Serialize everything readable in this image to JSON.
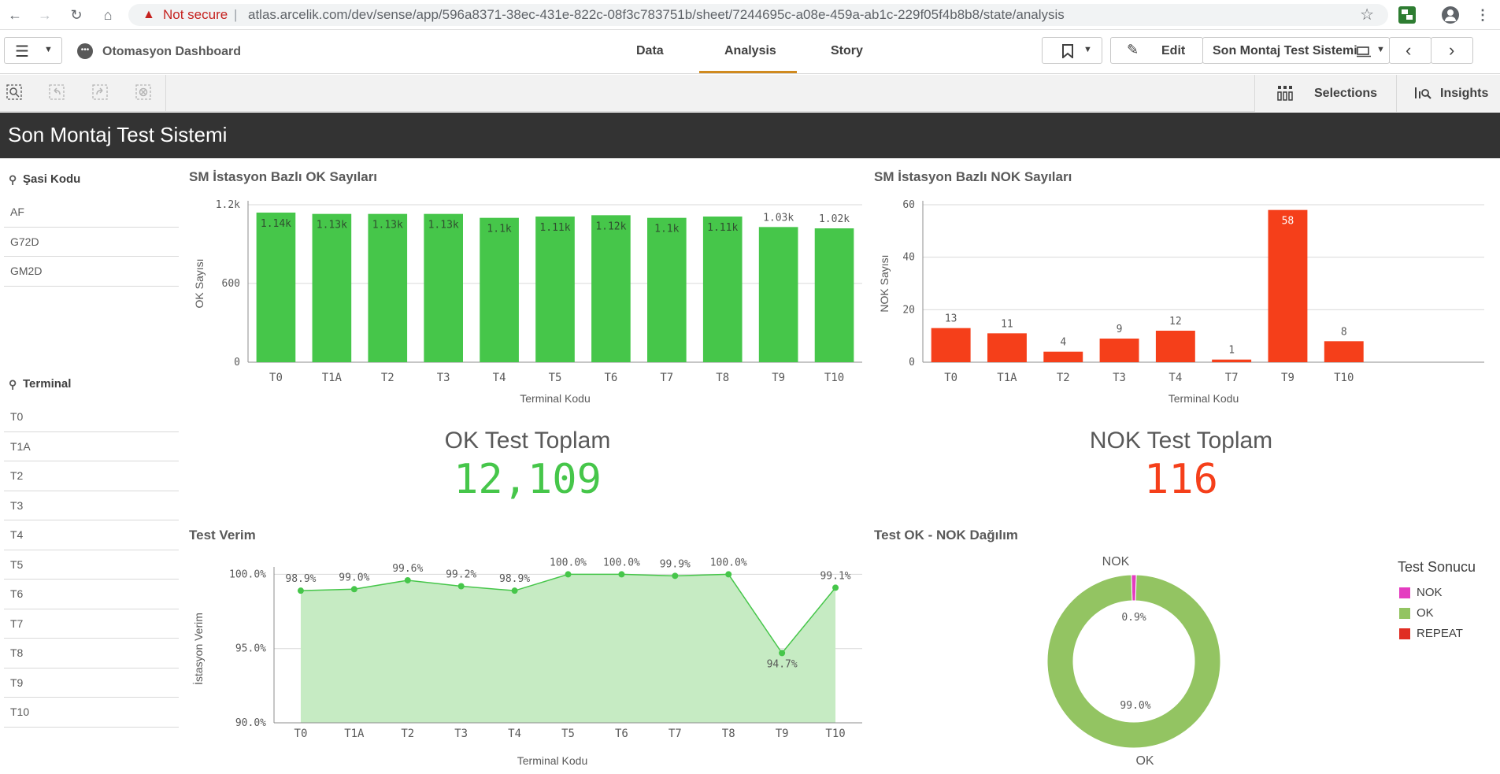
{
  "browser": {
    "not_secure": "Not secure",
    "separator": "|",
    "url": "atlas.arcelik.com/dev/sense/app/596a8371-38ec-431e-822c-08f3c783751b/sheet/7244695c-a08e-459a-ab1c-229f05f4b8b8/state/analysis"
  },
  "toolbar": {
    "app_title": "Otomasyon Dashboard",
    "tabs": [
      {
        "label": "Data"
      },
      {
        "label": "Analysis"
      },
      {
        "label": "Story"
      }
    ],
    "edit_label": "Edit",
    "sheet_name": "Son Montaj Test Sistemi"
  },
  "selbar": {
    "selections_label": "Selections",
    "insights_label": "Insights"
  },
  "sheet": {
    "title": "Son Montaj Test Sistemi"
  },
  "filters": {
    "sasi": {
      "title": "Şasi Kodu",
      "items": [
        "AF",
        "G72D",
        "GM2D"
      ]
    },
    "terminal": {
      "title": "Terminal",
      "items": [
        "T0",
        "T1A",
        "T2",
        "T3",
        "T4",
        "T5",
        "T6",
        "T7",
        "T8",
        "T9",
        "T10"
      ]
    }
  },
  "kpi": {
    "ok": {
      "label": "OK Test Toplam",
      "value": "12,109"
    },
    "nok": {
      "label": "NOK Test Toplam",
      "value": "116"
    }
  },
  "colors": {
    "ok_green": "#46c64a",
    "nok_red": "#f53f1a",
    "area_fill": "#c6ebc3",
    "donut_ok": "#93c462",
    "donut_nok": "#e43cc0",
    "repeat": "#e02e23"
  },
  "legend": {
    "title": "Test Sonucu",
    "items": [
      {
        "label": "NOK",
        "color": "#e43cc0"
      },
      {
        "label": "OK",
        "color": "#93c462"
      },
      {
        "label": "REPEAT",
        "color": "#e02e23"
      }
    ]
  },
  "chart_data": [
    {
      "id": "ok-bar",
      "type": "bar",
      "title": "SM İstasyon Bazlı OK Sayıları",
      "xlabel": "Terminal Kodu",
      "ylabel": "OK Sayısı",
      "ylim": [
        0,
        1200
      ],
      "yticks": [
        0,
        600,
        1200
      ],
      "ytick_labels": [
        "0",
        "600",
        "1.2k"
      ],
      "categories": [
        "T0",
        "T1A",
        "T2",
        "T3",
        "T4",
        "T5",
        "T6",
        "T7",
        "T8",
        "T9",
        "T10"
      ],
      "values": [
        1140,
        1130,
        1130,
        1130,
        1100,
        1110,
        1120,
        1100,
        1110,
        1030,
        1020
      ],
      "labels": [
        "1.14k",
        "1.13k",
        "1.13k",
        "1.13k",
        "1.1k",
        "1.11k",
        "1.12k",
        "1.1k",
        "1.11k",
        "1.03k",
        "1.02k"
      ]
    },
    {
      "id": "nok-bar",
      "type": "bar",
      "title": "SM İstasyon Bazlı NOK Sayıları",
      "xlabel": "Terminal Kodu",
      "ylabel": "NOK Sayısı",
      "ylim": [
        0,
        60
      ],
      "yticks": [
        0,
        20,
        40,
        60
      ],
      "ytick_labels": [
        "0",
        "20",
        "40",
        "60"
      ],
      "categories": [
        "T0",
        "T1A",
        "T2",
        "T3",
        "T4",
        "T7",
        "T9",
        "T10"
      ],
      "values": [
        13,
        11,
        4,
        9,
        12,
        1,
        58,
        8
      ],
      "labels": [
        "13",
        "11",
        "4",
        "9",
        "12",
        "1",
        "58",
        "8"
      ]
    },
    {
      "id": "verim-area",
      "type": "area",
      "title": "Test Verim",
      "xlabel": "Terminal Kodu",
      "ylabel": "İstasyon Verim",
      "ylim": [
        90,
        100.5
      ],
      "yticks": [
        90,
        95,
        100
      ],
      "ytick_labels": [
        "90.0%",
        "95.0%",
        "100.0%"
      ],
      "categories": [
        "T0",
        "T1A",
        "T2",
        "T3",
        "T4",
        "T5",
        "T6",
        "T7",
        "T8",
        "T9",
        "T10"
      ],
      "values": [
        98.9,
        99.0,
        99.6,
        99.2,
        98.9,
        100.0,
        100.0,
        99.9,
        100.0,
        94.7,
        99.1
      ],
      "labels": [
        "98.9%",
        "99.0%",
        "99.6%",
        "99.2%",
        "98.9%",
        "100.0%",
        "100.0%",
        "99.9%",
        "100.0%",
        "94.7%",
        "99.1%"
      ]
    },
    {
      "id": "ok-nok-donut",
      "type": "pie",
      "title": "Test OK - NOK Dağılım",
      "slices": [
        {
          "name": "NOK",
          "value": 0.9,
          "label": "0.9%"
        },
        {
          "name": "OK",
          "value": 99.0,
          "label": "99.0%"
        }
      ],
      "outer_labels": [
        "NOK",
        "OK"
      ]
    }
  ]
}
